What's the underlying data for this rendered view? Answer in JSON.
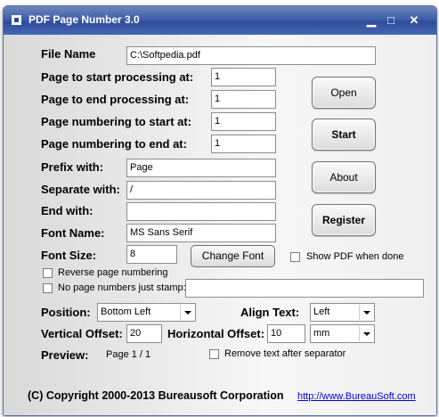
{
  "window": {
    "title": "PDF Page Number 3.0",
    "minimize": "▁",
    "maximize": "□",
    "close": "✕"
  },
  "labels": {
    "file_name": "File Name",
    "start_processing": "Page to start processing at:",
    "end_processing": "Page to end processing at:",
    "numbering_start": "Page numbering to start at:",
    "numbering_end": "Page numbering to end at:",
    "prefix": "Prefix with:",
    "separate": "Separate with:",
    "end_with": "End with:",
    "font_name": "Font Name:",
    "font_size": "Font Size:",
    "position": "Position:",
    "align": "Align Text:",
    "vertical_offset": "Vertical Offset:",
    "horizontal_offset": "Horizontal Offset:",
    "preview": "Preview:"
  },
  "fields": {
    "file_name": "C:\\Softpedia.pdf",
    "start_processing": "1",
    "end_processing": "1",
    "numbering_start": "1",
    "numbering_end": "1",
    "prefix": "Page",
    "separate": "/",
    "end_with": "",
    "font_name": "MS Sans Serif",
    "font_size": "8",
    "no_numbers_stamp": "",
    "vertical_offset": "20",
    "horizontal_offset": "10"
  },
  "selects": {
    "position": "Bottom Left",
    "align": "Left",
    "unit": "mm"
  },
  "buttons": {
    "open": "Open",
    "start": "Start",
    "about": "About",
    "register": "Register",
    "change_font": "Change Font"
  },
  "checkboxes": {
    "show_pdf": "Show PDF when done",
    "reverse": "Reverse page numbering",
    "no_numbers": "No page numbers just stamp:",
    "remove_text": "Remove text after separator"
  },
  "preview_value": "Page 1 / 1",
  "footer": {
    "copyright": "(C) Copyright 2000-2013 Bureausoft Corporation",
    "link": "http://www.BureauSoft.com"
  }
}
